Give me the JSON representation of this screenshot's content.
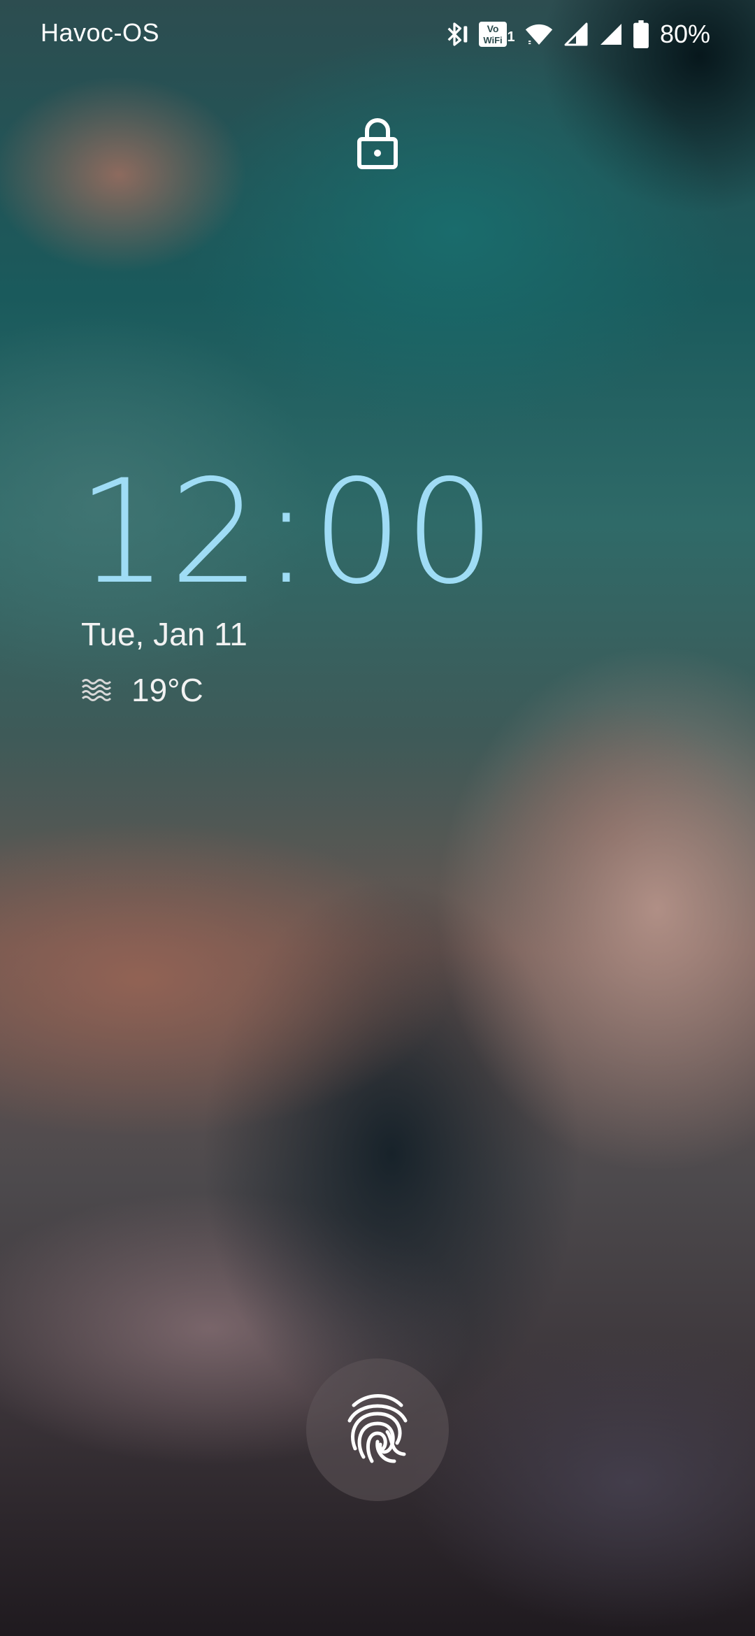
{
  "status_bar": {
    "carrier": "Havoc-OS",
    "volte_label_top": "Vo",
    "volte_label_bottom": "WiFi",
    "volte_sim": "1",
    "battery_percent": "80%",
    "icons": [
      "bluetooth-icon",
      "vowifi-icon",
      "wifi-icon",
      "signal-icon",
      "signal-icon",
      "battery-icon"
    ]
  },
  "lockscreen": {
    "lock_icon": "lock-icon",
    "time": "12:00",
    "date": "Tue, Jan 11",
    "weather_icon": "haze-icon",
    "temperature": "19°C",
    "fingerprint_icon": "fingerprint-icon"
  },
  "colors": {
    "clock": "#9fdcf5",
    "text": "#f2f2f2"
  }
}
